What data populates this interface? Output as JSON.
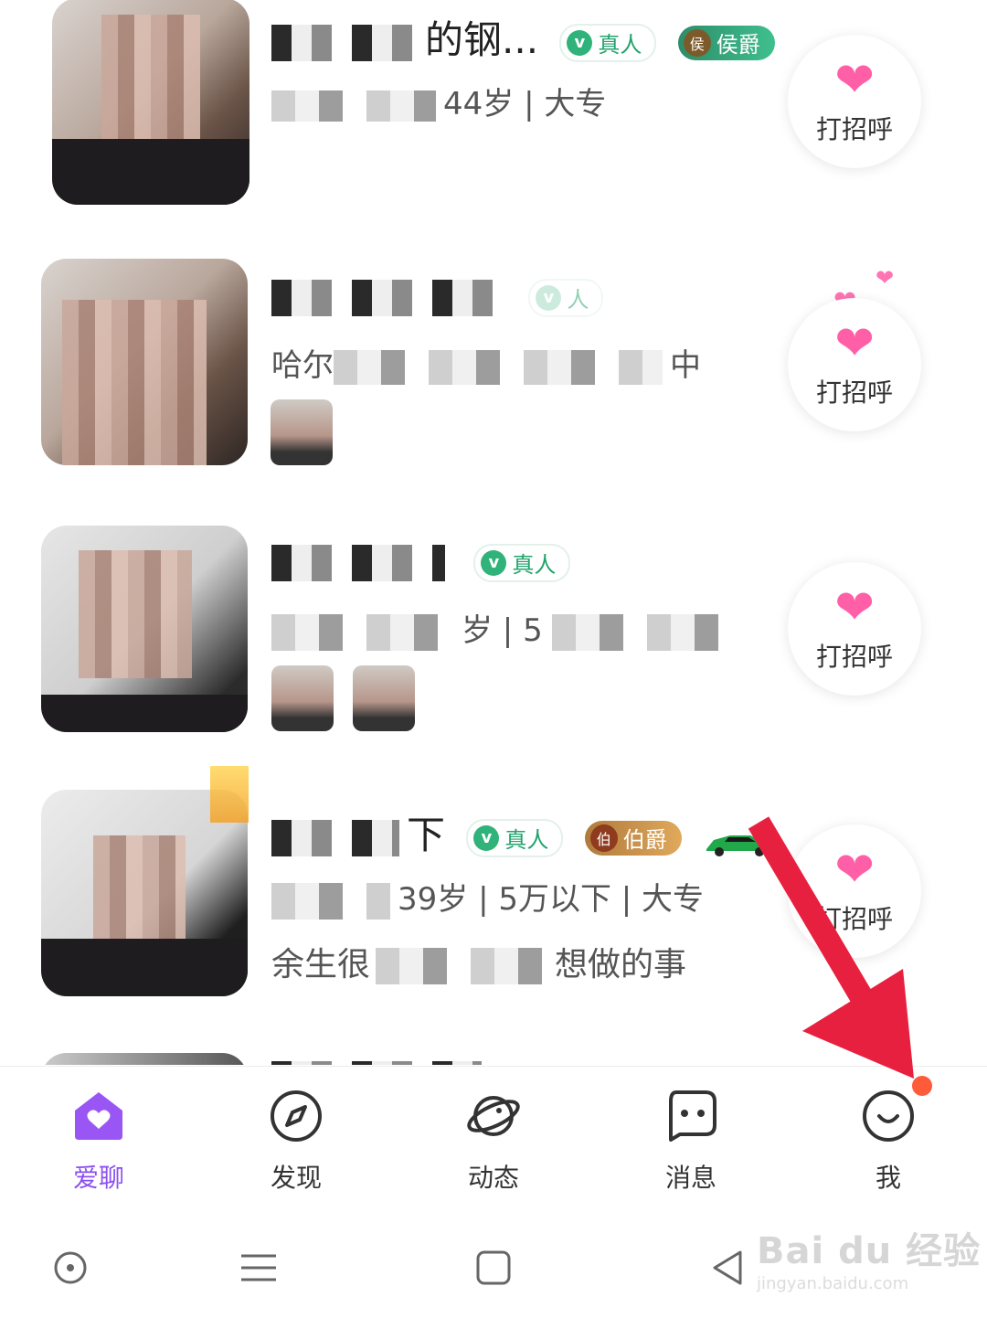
{
  "feed": [
    {
      "name": "的钢...",
      "verified_label": "真人",
      "rank_glyph": "侯",
      "rank_label": "侯爵",
      "meta": "44岁 | 大专",
      "greet_label": "打招呼"
    },
    {
      "name": "",
      "verified_label": "人",
      "meta": "哈尔",
      "meta_tail": "中",
      "greet_label": "打招呼"
    },
    {
      "name": "",
      "verified_label": "真人",
      "meta": "岁 | 5",
      "greet_label": "打招呼"
    },
    {
      "name": "下",
      "verified_label": "真人",
      "rank_glyph": "伯",
      "rank_label": "伯爵",
      "meta": "39岁 | 5万以下 | 大专",
      "bio_start": "余生很",
      "bio_end": "想做的事",
      "greet_label": "打招呼"
    }
  ],
  "nav": [
    {
      "label": "爱聊",
      "icon": "home-heart-icon",
      "active": true
    },
    {
      "label": "发现",
      "icon": "compass-icon",
      "active": false
    },
    {
      "label": "动态",
      "icon": "planet-icon",
      "active": false
    },
    {
      "label": "消息",
      "icon": "chat-bubble-icon",
      "active": false
    },
    {
      "label": "我",
      "icon": "smile-icon",
      "active": false
    }
  ],
  "colors": {
    "accent": "#8a4ff0",
    "heart": "#ff5fa6",
    "verified": "#22a36c",
    "notification": "#ff5a3a",
    "arrow": "#e8203f"
  },
  "watermark": {
    "brand": "Bai du 经验",
    "url": "jingyan.baidu.com"
  }
}
